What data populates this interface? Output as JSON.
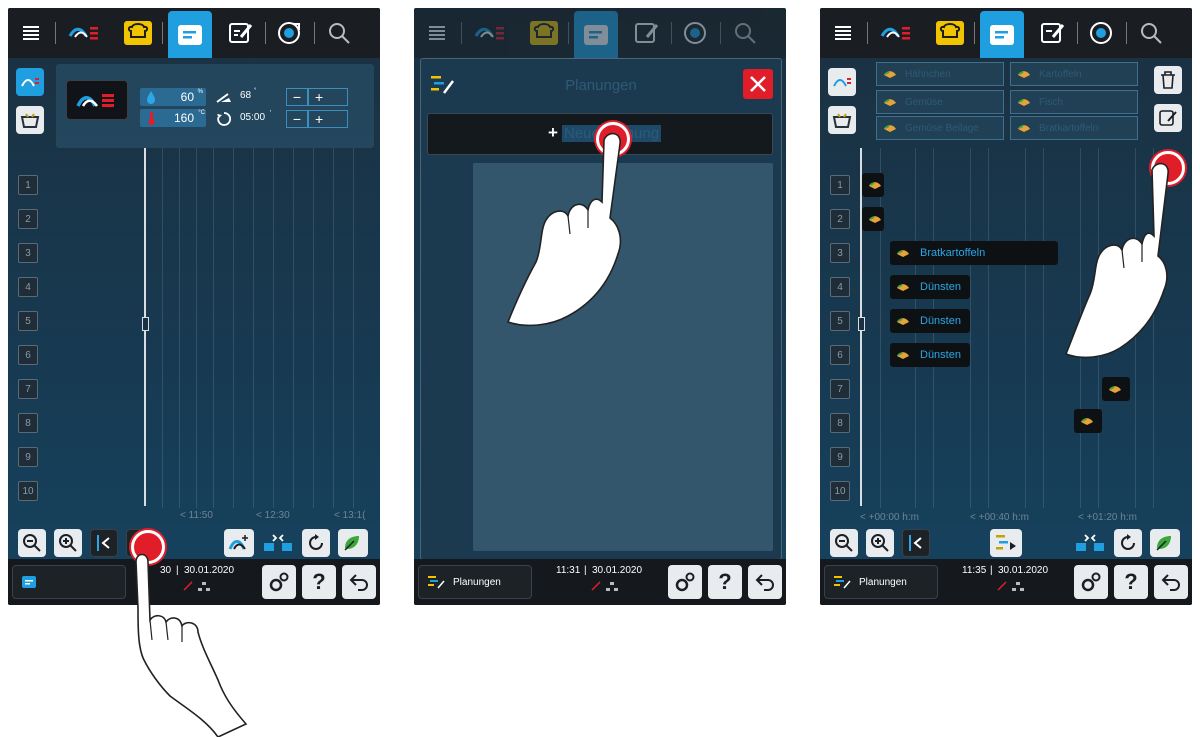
{
  "accent_blue": "#1f9fe0",
  "alert_red": "#e21d2a",
  "screens": [
    {
      "timeline_labels": [
        "< 11:50",
        "< 12:30",
        "< 13:1("
      ],
      "rows": [
        "1",
        "2",
        "3",
        "4",
        "5",
        "6",
        "7",
        "8",
        "9",
        "10"
      ],
      "params": {
        "humidity": "60",
        "humidity_unit": "%",
        "temperature": "160",
        "temperature_unit": "°C",
        "core_temp": "68",
        "core_temp_unit": "°",
        "time": "05:00",
        "time_unit": "'"
      },
      "status_time": "30",
      "status_date": "30.01.2020"
    },
    {
      "dialog_title": "Planungen",
      "new_plan_prefix": "+",
      "new_plan_label": "Neue Planung",
      "bottom_label": "Planungen",
      "status_time": "11:31",
      "status_date": "30.01.2020"
    },
    {
      "rows": [
        "1",
        "2",
        "3",
        "4",
        "5",
        "6",
        "7",
        "8",
        "9",
        "10"
      ],
      "top_chips": [
        "Hähnchen",
        "Kartoffeln",
        "Gemüse",
        "Fisch",
        "Gemüse Beilage",
        "Bratkartoffeln"
      ],
      "chips": [
        "Bratkartoffeln",
        "Dünsten",
        "Dünsten",
        "Dünsten"
      ],
      "timeline_labels": [
        "< +00:00 h:m",
        "< +00:40 h:m",
        "< +01:20 h:m"
      ],
      "bottom_label": "Planungen",
      "status_time": "11:35",
      "status_date": "30.01.2020"
    }
  ]
}
